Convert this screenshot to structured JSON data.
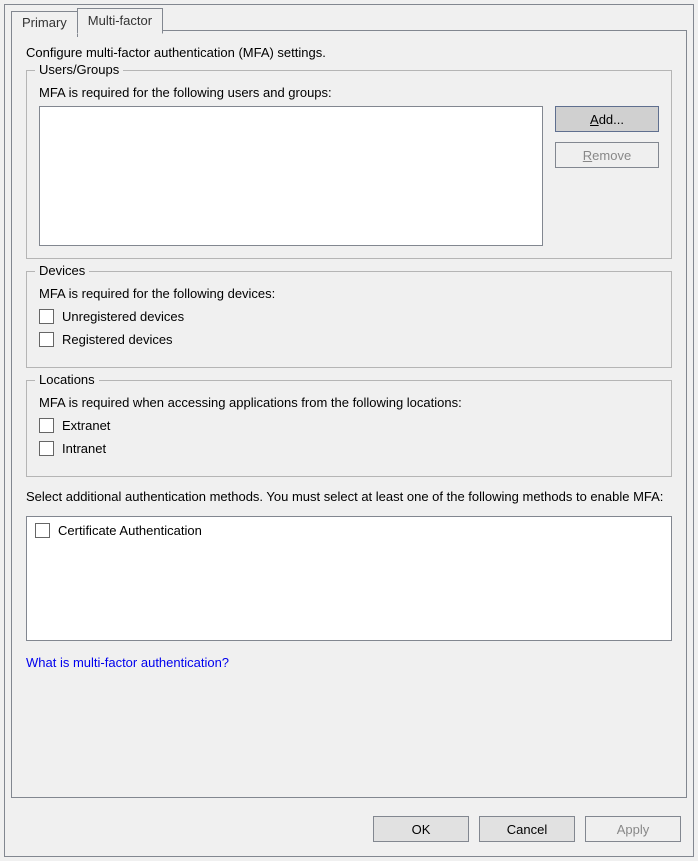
{
  "tabs": {
    "primary": "Primary",
    "multifactor": "Multi-factor"
  },
  "intro": "Configure multi-factor authentication (MFA) settings.",
  "usersGroups": {
    "legend": "Users/Groups",
    "label": "MFA is required for the following users and groups:",
    "addBtnPrefix": "A",
    "addBtnRest": "dd...",
    "removeBtnPrefix": "R",
    "removeBtnRest": "emove"
  },
  "devices": {
    "legend": "Devices",
    "label": "MFA is required for the following devices:",
    "unregistered": "Unregistered devices",
    "registered": "Registered devices"
  },
  "locations": {
    "legend": "Locations",
    "label": "MFA is required when accessing applications from the following locations:",
    "extranet": "Extranet",
    "intranet": "Intranet"
  },
  "methodsPara": "Select additional authentication methods. You must select at least one of the following methods to enable MFA:",
  "methods": {
    "certAuth": "Certificate Authentication"
  },
  "helpLink": "What is multi-factor authentication?",
  "buttons": {
    "ok": "OK",
    "cancel": "Cancel",
    "apply": "Apply"
  }
}
